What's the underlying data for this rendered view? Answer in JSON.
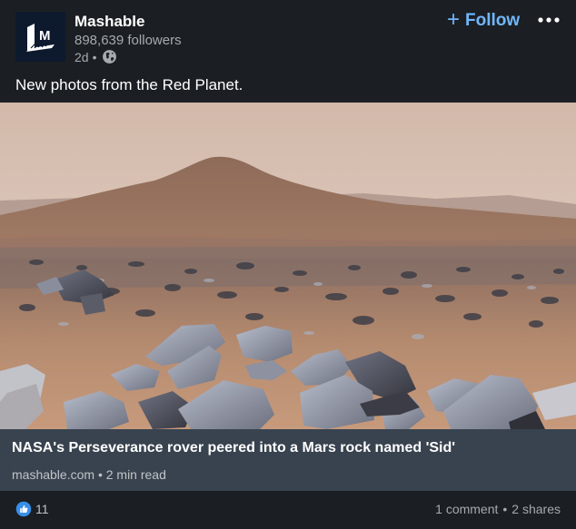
{
  "post": {
    "actor": {
      "name": "Mashable",
      "followers": "898,639 followers",
      "time": "2d",
      "separator": "•",
      "logo_letter": "M"
    },
    "follow_label": "Follow",
    "commentary": "New photos from the Red Planet.",
    "article": {
      "title": "NASA's Perseverance rover peered into a Mars rock named 'Sid'",
      "source": "mashable.com",
      "separator": "•",
      "read_time": "2 min read"
    },
    "social": {
      "reaction_count": "11",
      "comments": "1 comment",
      "separator": "•",
      "shares": "2 shares"
    }
  },
  "colors": {
    "background": "#1b1f23",
    "accent": "#71b7fb",
    "article_bar": "#38434f",
    "secondary_text": "#a6aaad",
    "like_blue": "#378fe9"
  },
  "icons": {
    "visibility": "globe-icon",
    "more": "more-options-icon",
    "reaction": "like-reaction-icon",
    "follow": "plus-icon"
  }
}
